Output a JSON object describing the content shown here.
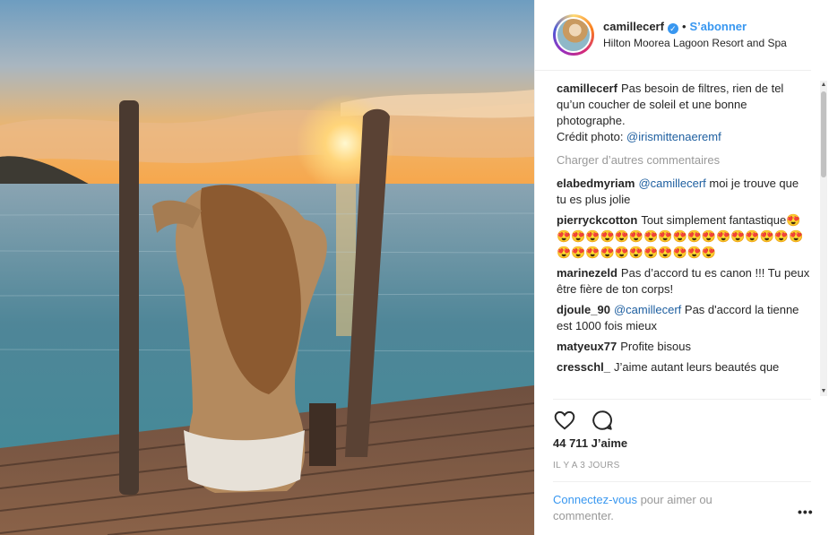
{
  "header": {
    "username": "camillecerf",
    "verified_glyph": "✓",
    "separator": "•",
    "follow_label": "S’abonner",
    "location": "Hilton Moorea Lagoon Resort and Spa"
  },
  "caption": {
    "user": "camillecerf",
    "text": "Pas besoin de filtres, rien de tel qu’un coucher de soleil et une bonne photographe.",
    "credit_prefix": "Crédit photo: ",
    "credit_mention": "@irismittenaeremf"
  },
  "load_more_label": "Charger d’autres commentaires",
  "comments": [
    {
      "user": "elabedmyriam",
      "mention": "@camillecerf",
      "text": " moi je trouve que tu es plus jolie"
    },
    {
      "user": "pierryckcotton",
      "mention": "",
      "text": "Tout simplement fantastique😍😍😍😍😍😍😍😍😍😍😍😍😍😍😍😍😍😍😍😍😍😍😍😍😍😍😍😍😍"
    },
    {
      "user": "marinezeld",
      "mention": "",
      "text": "Pas d’accord tu es canon !!! Tu peux être fière de ton corps!"
    },
    {
      "user": "djoule_90",
      "mention": "@camillecerf",
      "text": " Pas d'accord la tienne est 1000 fois mieux"
    },
    {
      "user": "matyeux77",
      "mention": "",
      "text": "Profite bisous"
    },
    {
      "user": "cresschl_",
      "mention": "",
      "text": "J’aime autant leurs beautés que"
    }
  ],
  "actions": {
    "like_icon": "heart-icon",
    "comment_icon": "speech-bubble-icon"
  },
  "likes_label": "44 711 J’aime",
  "time_label": "IL Y A 3 JOURS",
  "login_prompt": {
    "link": "Connectez-vous",
    "rest": " pour aimer ou commenter."
  },
  "more_options_label": "•••",
  "scrollbar": {
    "up_glyph": "▲",
    "down_glyph": "▼"
  },
  "colors": {
    "accent": "#3897f0",
    "text": "#262626",
    "muted": "#999999",
    "mention": "#1e5fa0"
  }
}
